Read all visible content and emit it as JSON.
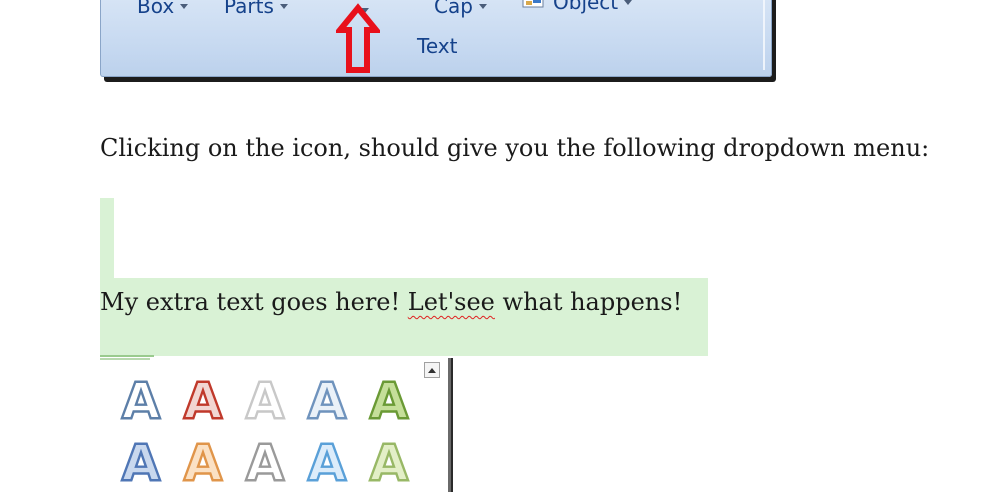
{
  "ribbon": {
    "buttons": [
      {
        "label": "Box"
      },
      {
        "label": "Parts"
      },
      {
        "label": "Cap"
      },
      {
        "label": "Object"
      }
    ],
    "group_label": "Text",
    "arrow_icon": "red-up-arrow",
    "object_icon": "object-icon"
  },
  "document": {
    "paragraph1": "Clicking on the icon, should give you the following dropdown menu:",
    "paragraph2_before": "My extra text goes here! ",
    "paragraph2_misspelled": "Let'see",
    "paragraph2_after": " what happens!",
    "highlight_color": "#d9f2d5"
  },
  "wordart": {
    "glyph": "A",
    "row1": [
      {
        "fill": "#ffffff",
        "stroke": "#5d7fa8"
      },
      {
        "fill": "#f2d6d2",
        "stroke": "#c0392b"
      },
      {
        "fill": "#ffffff",
        "stroke": "#c8c8c8"
      },
      {
        "fill": "#eaf1f8",
        "stroke": "#6f93bd"
      },
      {
        "fill": "#c5df99",
        "stroke": "#6a9a35"
      }
    ],
    "row2": [
      {
        "fill": "#c9d8ee",
        "stroke": "#4f76b5"
      },
      {
        "fill": "#fbe1c4",
        "stroke": "#e0954a"
      },
      {
        "fill": "#ffffff",
        "stroke": "#9a9a9a"
      },
      {
        "fill": "#dcecfa",
        "stroke": "#5aa0d8"
      },
      {
        "fill": "#e3efc7",
        "stroke": "#98b866"
      }
    ]
  }
}
